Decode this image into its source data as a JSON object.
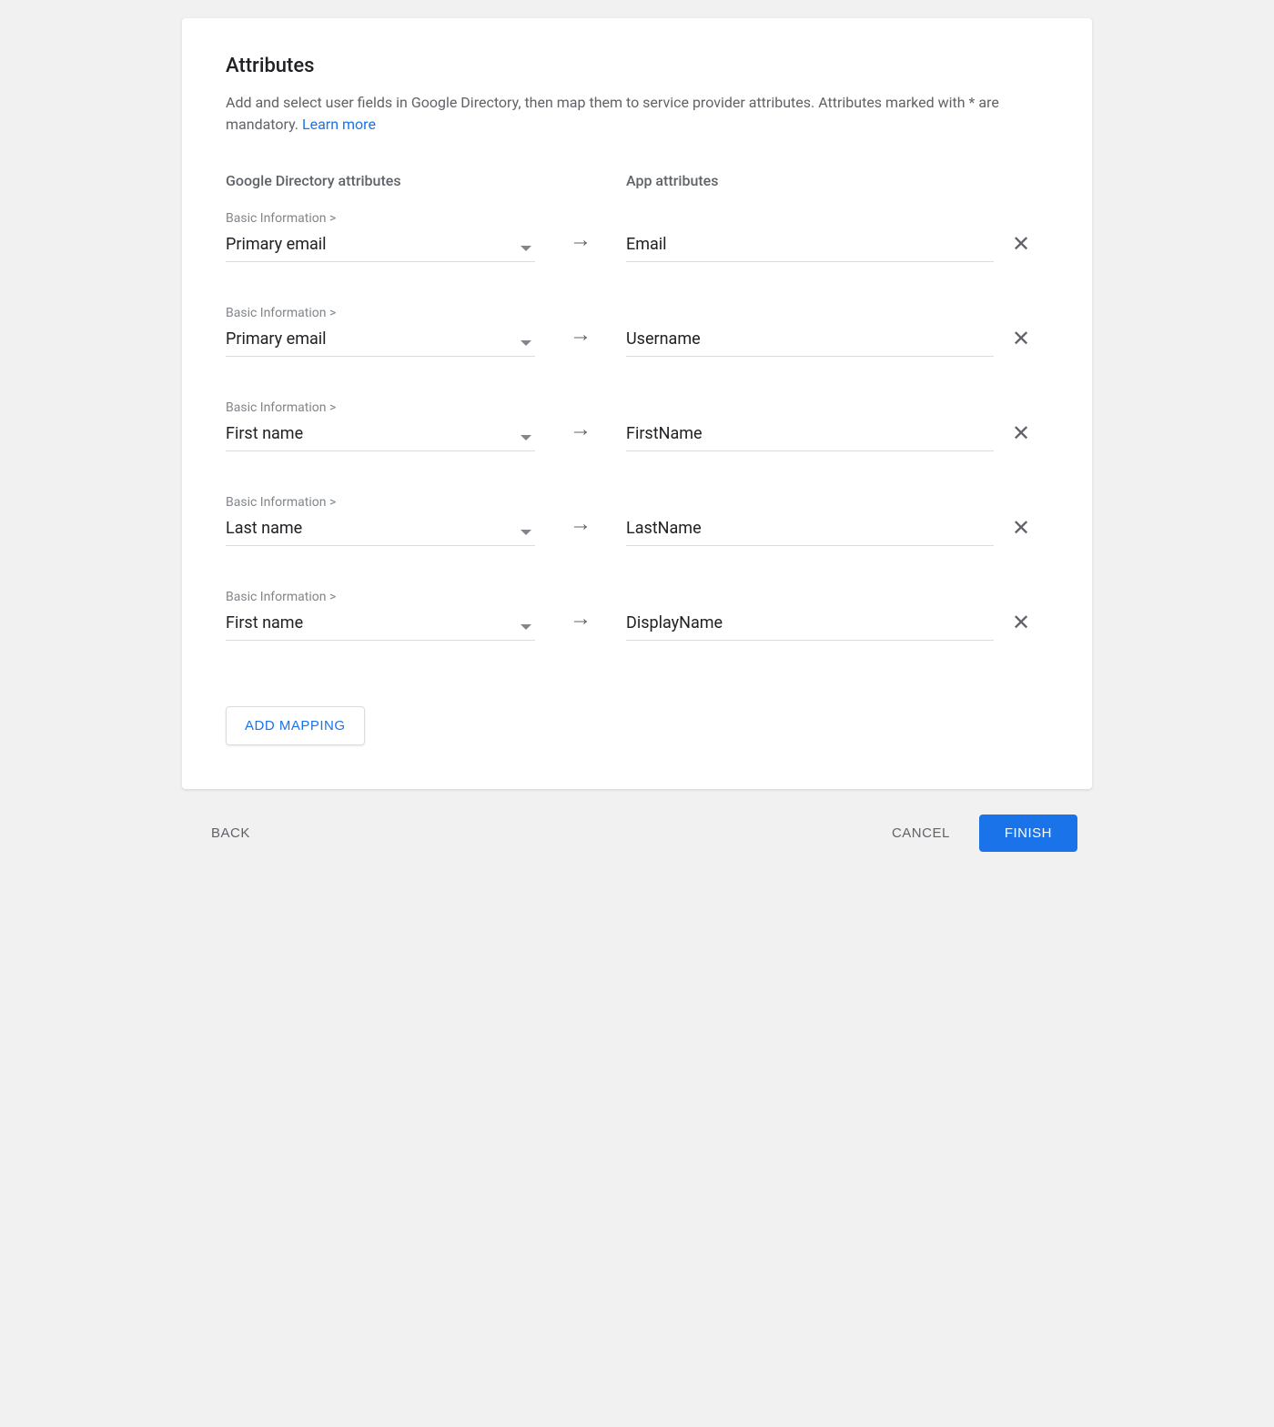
{
  "header": {
    "title": "Attributes",
    "description": "Add and select user fields in Google Directory, then map them to service provider attributes. Attributes marked with * are mandatory. ",
    "learn_more": "Learn more"
  },
  "columns": {
    "left": "Google Directory attributes",
    "right": "App attributes"
  },
  "mappings": [
    {
      "group": "Basic Information >",
      "directory_attr": "Primary email",
      "app_attr": "Email"
    },
    {
      "group": "Basic Information >",
      "directory_attr": "Primary email",
      "app_attr": "Username"
    },
    {
      "group": "Basic Information >",
      "directory_attr": "First name",
      "app_attr": "FirstName"
    },
    {
      "group": "Basic Information >",
      "directory_attr": "Last name",
      "app_attr": "LastName"
    },
    {
      "group": "Basic Information >",
      "directory_attr": "First name",
      "app_attr": "DisplayName"
    }
  ],
  "buttons": {
    "add_mapping": "ADD MAPPING",
    "back": "BACK",
    "cancel": "CANCEL",
    "finish": "FINISH"
  }
}
